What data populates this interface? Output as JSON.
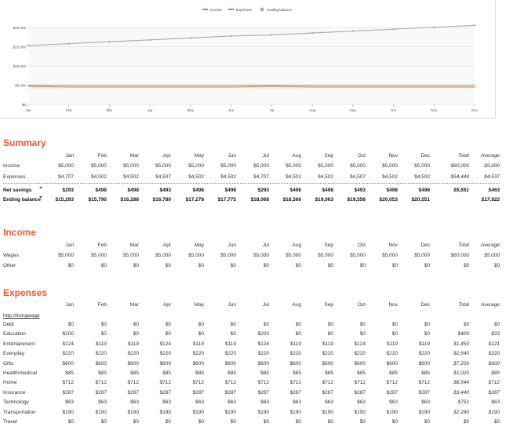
{
  "chart_data": {
    "type": "line",
    "categories": [
      "Jan",
      "Feb",
      "Mar",
      "Apr",
      "May",
      "Jun",
      "Jul",
      "Aug",
      "Sep",
      "Oct",
      "Nov",
      "Dec"
    ],
    "ytick_labels": [
      "$0",
      "$5,000",
      "$10,000",
      "$15,000",
      "$20,000"
    ],
    "ylim": [
      0,
      20000
    ],
    "grid": true,
    "legend_position": "top-center",
    "series": [
      {
        "name": "Income",
        "color": "#5cb85c",
        "values": [
          5000,
          5000,
          5000,
          5000,
          5000,
          5000,
          5000,
          5000,
          5000,
          5000,
          5000,
          5000
        ]
      },
      {
        "name": "Expenses",
        "color": "#e8743b",
        "values": [
          4707,
          4502,
          4502,
          4507,
          4502,
          4502,
          4707,
          4502,
          4502,
          4507,
          4502,
          4502
        ]
      },
      {
        "name": "Ending balance",
        "color": "#aaaaaa",
        "values": [
          15293,
          15790,
          16288,
          16780,
          17278,
          17775,
          18068,
          18566,
          19063,
          19556,
          20053,
          20551
        ]
      }
    ]
  },
  "months": [
    "Jan",
    "Feb",
    "Mar",
    "Apr",
    "May",
    "Jun",
    "Jul",
    "Aug",
    "Sep",
    "Oct",
    "Nov",
    "Dec"
  ],
  "total_label": "Total",
  "average_label": "Average",
  "summary": {
    "title": "Summary",
    "rows": [
      {
        "label": "Income",
        "values": [
          "$5,000",
          "$5,000",
          "$5,000",
          "$5,000",
          "$5,000",
          "$5,000",
          "$5,000",
          "$5,000",
          "$5,000",
          "$5,000",
          "$5,000",
          "$5,000"
        ],
        "total": "$60,000",
        "average": "$5,000"
      },
      {
        "label": "Expenses",
        "values": [
          "$4,707",
          "$4,502",
          "$4,502",
          "$4,507",
          "$4,502",
          "$4,502",
          "$4,707",
          "$4,502",
          "$4,502",
          "$4,507",
          "$4,502",
          "$4,502"
        ],
        "total": "$54,449",
        "average": "$4,537"
      }
    ],
    "bold_rows": [
      {
        "label": "Net savings",
        "values": [
          "$293",
          "$498",
          "$498",
          "$493",
          "$498",
          "$498",
          "$293",
          "$498",
          "$498",
          "$493",
          "$498",
          "$498"
        ],
        "total": "$5,551",
        "average": "$463"
      },
      {
        "label": "Ending balance",
        "values": [
          "$15,293",
          "$15,790",
          "$16,288",
          "$16,780",
          "$17,278",
          "$17,775",
          "$18,068",
          "$18,566",
          "$19,063",
          "$19,556",
          "$20,053",
          "$20,551"
        ],
        "total": "",
        "average": "$17,922"
      }
    ]
  },
  "income": {
    "title": "Income",
    "rows": [
      {
        "label": "Wages",
        "values": [
          "$5,000",
          "$5,000",
          "$5,000",
          "$5,000",
          "$5,000",
          "$5,000",
          "$5,000",
          "$5,000",
          "$5,000",
          "$5,000",
          "$5,000",
          "$5,000"
        ],
        "total": "$60,000",
        "average": "$5,000"
      },
      {
        "label": "Other",
        "values": [
          "$0",
          "$0",
          "$0",
          "$0",
          "$0",
          "$0",
          "$0",
          "$0",
          "$0",
          "$0",
          "$0",
          "$0"
        ],
        "total": "$0",
        "average": "$0"
      }
    ]
  },
  "expenses": {
    "title": "Expenses",
    "link": "http://livingwage",
    "rows": [
      {
        "label": "Debt",
        "values": [
          "$0",
          "$0",
          "$0",
          "$0",
          "$0",
          "$0",
          "$0",
          "$0",
          "$0",
          "$0",
          "$0",
          "$0"
        ],
        "total": "$0",
        "average": "$0"
      },
      {
        "label": "Education",
        "values": [
          "$200",
          "$0",
          "$0",
          "$0",
          "$0",
          "$0",
          "$200",
          "$0",
          "$0",
          "$0",
          "$0",
          "$0"
        ],
        "total": "$400",
        "average": "$33"
      },
      {
        "label": "Entertainment",
        "values": [
          "$124",
          "$119",
          "$119",
          "$124",
          "$119",
          "$119",
          "$124",
          "$119",
          "$119",
          "$124",
          "$119",
          "$119"
        ],
        "total": "$1,450",
        "average": "$121"
      },
      {
        "label": "Everyday",
        "values": [
          "$220",
          "$220",
          "$220",
          "$220",
          "$220",
          "$220",
          "$220",
          "$220",
          "$220",
          "$220",
          "$220",
          "$220"
        ],
        "total": "$2,640",
        "average": "$220"
      },
      {
        "label": "Gifts",
        "values": [
          "$600",
          "$600",
          "$600",
          "$600",
          "$600",
          "$600",
          "$600",
          "$600",
          "$600",
          "$600",
          "$600",
          "$600"
        ],
        "total": "$7,200",
        "average": "$600"
      },
      {
        "label": "Health/medical",
        "values": [
          "$85",
          "$85",
          "$85",
          "$85",
          "$85",
          "$85",
          "$85",
          "$85",
          "$85",
          "$85",
          "$85",
          "$85"
        ],
        "total": "$1,020",
        "average": "$85"
      },
      {
        "label": "Home",
        "values": [
          "$712",
          "$712",
          "$712",
          "$712",
          "$712",
          "$712",
          "$712",
          "$712",
          "$712",
          "$712",
          "$712",
          "$712"
        ],
        "total": "$8,544",
        "average": "$712"
      },
      {
        "label": "Insurance",
        "values": [
          "$287",
          "$287",
          "$287",
          "$287",
          "$287",
          "$287",
          "$287",
          "$287",
          "$287",
          "$287",
          "$287",
          "$287"
        ],
        "total": "$3,440",
        "average": "$287"
      },
      {
        "label": "Technology",
        "values": [
          "$63",
          "$63",
          "$63",
          "$63",
          "$63",
          "$63",
          "$63",
          "$63",
          "$63",
          "$63",
          "$63",
          "$63"
        ],
        "total": "$751",
        "average": "$63"
      },
      {
        "label": "Transportation",
        "values": [
          "$190",
          "$190",
          "$190",
          "$190",
          "$190",
          "$190",
          "$190",
          "$190",
          "$190",
          "$190",
          "$190",
          "$190"
        ],
        "total": "$2,280",
        "average": "$190"
      },
      {
        "label": "Travel",
        "values": [
          "$0",
          "$0",
          "$0",
          "$0",
          "$0",
          "$0",
          "$0",
          "$0",
          "$0",
          "$0",
          "$0",
          "$0"
        ],
        "total": "$0",
        "average": "$0"
      }
    ]
  }
}
